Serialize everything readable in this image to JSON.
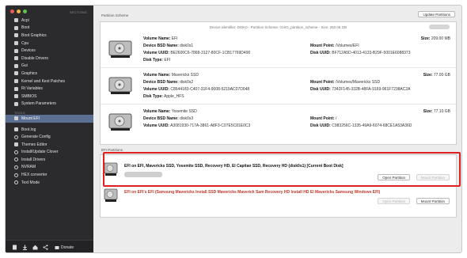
{
  "sidebar": {
    "header": "SECTIONS",
    "items": [
      {
        "label": "Acpi",
        "kind": "sq"
      },
      {
        "label": "Boot",
        "kind": "sq"
      },
      {
        "label": "Boot Graphics",
        "kind": "sq"
      },
      {
        "label": "Cpu",
        "kind": "sq"
      },
      {
        "label": "Devices",
        "kind": "sq"
      },
      {
        "label": "Disable Drivers",
        "kind": "sq"
      },
      {
        "label": "Gui",
        "kind": "sq"
      },
      {
        "label": "Graphics",
        "kind": "sq"
      },
      {
        "label": "Kernel and Kext Patches",
        "kind": "sq"
      },
      {
        "label": "Rt Variables",
        "kind": "sq"
      },
      {
        "label": "SMBIOS",
        "kind": "sq"
      },
      {
        "label": "System Parameters",
        "kind": "sq"
      }
    ],
    "tools_header": "TOOLS",
    "tools": [
      {
        "label": "Mount EFI",
        "kind": "sq",
        "active": true
      },
      {
        "label": "Boot.log",
        "kind": "sq"
      },
      {
        "label": "Generate Config",
        "kind": "dot"
      },
      {
        "label": "Themes Editor",
        "kind": "sq"
      },
      {
        "label": "Install/Update Clover",
        "kind": "dot"
      },
      {
        "label": "Install Drivers",
        "kind": "dot"
      },
      {
        "label": "NVRAM",
        "kind": "dot"
      },
      {
        "label": "HEX converter",
        "kind": "dot"
      },
      {
        "label": "Text Mode",
        "kind": "dot"
      }
    ],
    "bottom": {
      "donate_label": "Donate"
    }
  },
  "main": {
    "scheme_label": "Partition Scheme",
    "update_button": "Update Partitions",
    "scheme_title": "Device Identifier: DISK0 - Partition Scheme: GUID_partition_scheme - Size: 250.06 GB",
    "volumes": [
      {
        "name": "EFI",
        "bsd": "disk0s1",
        "uuid": "BE2600C6-7868-3127-80CF-1CB17769D490",
        "type": "EFI",
        "mount": "/Volumes/EFI",
        "size": "209.00 MB",
        "disk_uuid": "BF712A5D-4013-4133-B29F-5001E6088373"
      },
      {
        "name": "Mavericks SSD",
        "bsd": "disk0s2",
        "uuid": "C8644183-C407-31F4-9008-5219AC07D048",
        "type": "Apple_HFS",
        "mount": "/Volumes/Mavericks SSD",
        "size": "77.00 GB",
        "disk_uuid": "7342F145-332B-48FA-9169-961F7238AC2A"
      },
      {
        "name": "Yosemite SSD",
        "bsd": "disk0s3",
        "uuid": "A3081930-717A-3861-A8F3-C07E5C81E0C3",
        "type": "",
        "mount": "/",
        "size": "77.10 GB",
        "disk_uuid": "C983256C-1335-49A9-6074-68CE1A53A36D"
      }
    ],
    "labels": {
      "volume_name": "Volume Name:",
      "bsd_name": "Device BSD Name:",
      "volume_uuid": "Volume UUID:",
      "disk_type": "Disk Type:",
      "mount_point": "Mount Point:",
      "size": "Size:",
      "disk_uuid": "Disk UUID:"
    },
    "efi_label": "EFI Partitions",
    "efi_rows": [
      {
        "title": "EFI on EFI, Mavericks SSD, Yosemite SSD, Recovery HD, El Capitan SSD, Recovery HD (disk0s1) [Current Boot Disk]",
        "open": "Open Partition",
        "mount": "Mount Partition"
      },
      {
        "title": "EFI on EFI's EFI (Samsung Mavericks Install SSD Mavericks Maverick Sam Recovery HD Install HD El Mavericks Samsung Windows EFI)",
        "open": "Open Partition",
        "mount": "Mount Partition"
      }
    ]
  }
}
